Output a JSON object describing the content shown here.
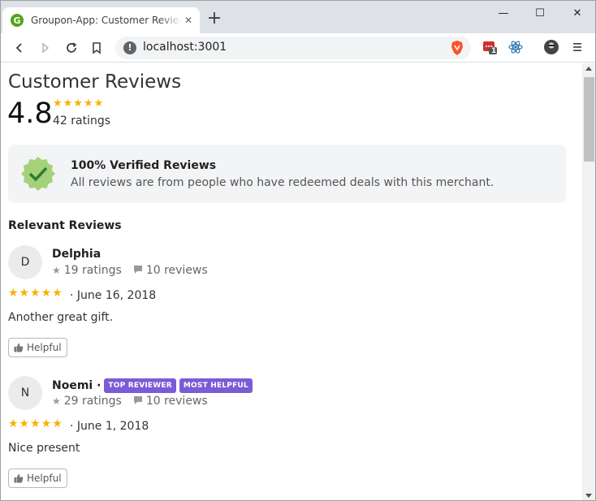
{
  "browser": {
    "tab_title": "Groupon-App: Customer Review C",
    "favicon_letter": "G",
    "url": "localhost:3001",
    "extension_badge": "1",
    "new_tab": "+",
    "minimize": "—",
    "maximize": "☐",
    "close": "✕"
  },
  "summary": {
    "heading": "Customer Reviews",
    "rating": "4.8",
    "stars": "★★★★★",
    "count": "42 ratings"
  },
  "verified": {
    "title": "100% Verified Reviews",
    "subtitle": "All reviews are from people who have redeemed deals with this merchant."
  },
  "relevant_heading": "Relevant Reviews",
  "reviews": [
    {
      "initial": "D",
      "name": "Delphia",
      "ratings": "19 ratings",
      "reviews": "10 reviews",
      "stars": "★★★★★",
      "date": "· June 16, 2018",
      "text": "Another great gift.",
      "helpful": "Helpful",
      "tags": []
    },
    {
      "initial": "N",
      "name": "Noemi ·",
      "ratings": "29 ratings",
      "reviews": "10 reviews",
      "stars": "★★★★★",
      "date": "· June 1, 2018",
      "text": "Nice present",
      "helpful": "Helpful",
      "tags": [
        "TOP REVIEWER",
        "MOST HELPFUL"
      ]
    }
  ],
  "colors": {
    "star": "#f5b301",
    "tag": "#7b5bd6",
    "verified_badge": "#8bc34a"
  }
}
